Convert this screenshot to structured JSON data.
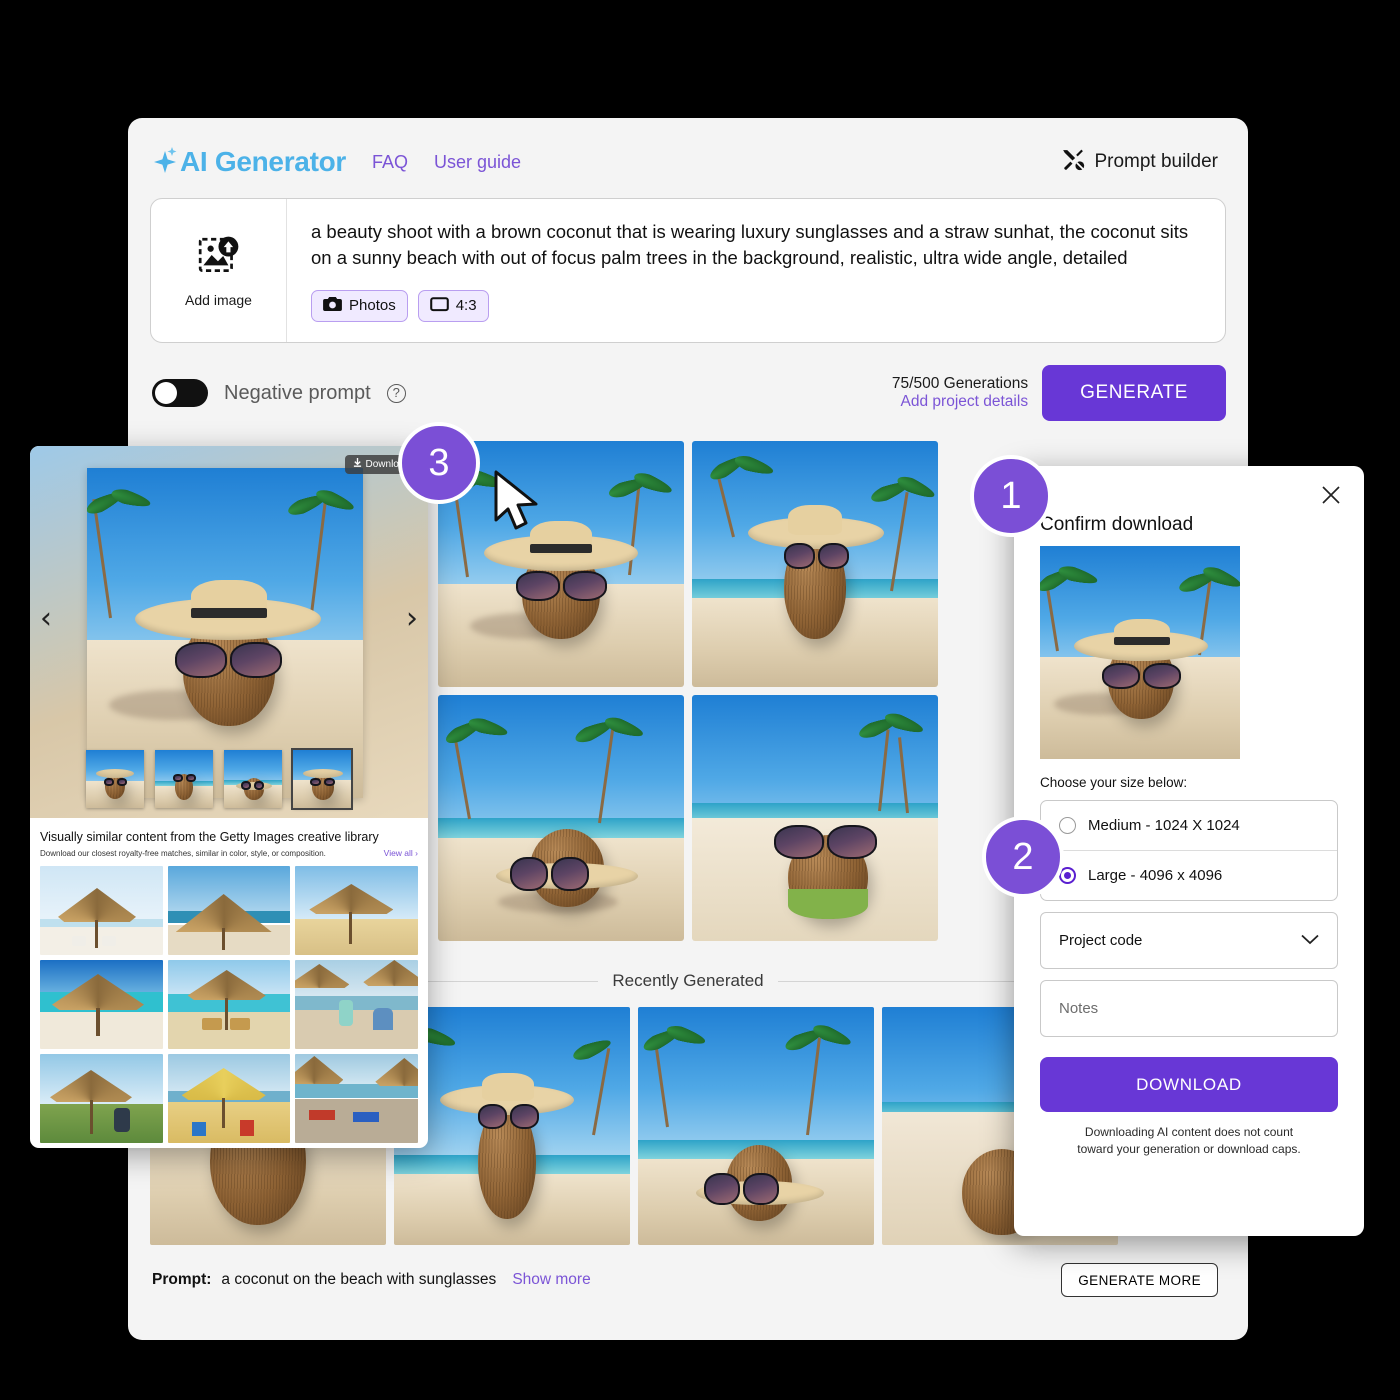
{
  "app": {
    "brand": "AI Generator",
    "nav": [
      {
        "label": "FAQ"
      },
      {
        "label": "User guide"
      }
    ],
    "prompt_builder_label": "Prompt builder",
    "prompt_builder_icon": "tools-icon"
  },
  "prompt_card": {
    "add_image_label": "Add image",
    "add_image_icon": "image-upload-icon",
    "prompt_value": "a beauty shoot with a brown coconut that is wearing luxury sunglasses and a straw sunhat, the coconut sits on a sunny beach with out of focus palm trees in the background, realistic, ultra wide angle, detailed",
    "chips": [
      {
        "label": "Photos",
        "icon": "camera-icon"
      },
      {
        "label": "4:3",
        "icon": "aspect-ratio-icon"
      }
    ]
  },
  "generate_row": {
    "negative_prompt_label": "Negative prompt",
    "help_icon": "question-mark-icon",
    "toggle_state": "off",
    "generations_count": "75/500 Generations",
    "project_details_label": "Add project details",
    "generate_button": "GENERATE"
  },
  "recently": {
    "divider_label": "Recently Generated"
  },
  "bottom_bar": {
    "prompt_label": "Prompt:",
    "prompt_text": "a coconut on the beach with sunglasses",
    "show_more": "Show more",
    "generate_more_button": "GENERATE MORE"
  },
  "lightbox": {
    "download_button": "Download",
    "download_icon": "download-icon",
    "prev_icon": "chevron-left-icon",
    "next_icon": "chevron-right-icon",
    "similar_title": "Visually similar content from the Getty Images creative library",
    "similar_subtitle": "Download our closest royalty-free matches, similar in color, style, or composition.",
    "view_all": "View all  ›",
    "selected_thumb_index": 3
  },
  "dialog": {
    "close_icon": "close-icon",
    "title": "Confirm download",
    "choose_size_label": "Choose your size below:",
    "size_options": [
      {
        "label": "Medium - 1024  X 1024",
        "selected": false
      },
      {
        "label": "Large - 4096 x 4096",
        "selected": true
      }
    ],
    "project_code_label": "Project code",
    "project_code_icon": "chevron-down-icon",
    "notes_placeholder": "Notes",
    "download_button": "DOWNLOAD",
    "note_line1": "Downloading AI content does not count",
    "note_line2": "toward your generation or download caps."
  },
  "badges": {
    "one": "1",
    "two": "2",
    "three": "3"
  },
  "colors": {
    "brand_blue": "#4cb2e8",
    "accent_purple": "#6837d6",
    "link_purple": "#7b54d6",
    "badge_purple": "#7b4fd6",
    "window_bg": "#f4f4f4",
    "page_bg": "#000000"
  }
}
